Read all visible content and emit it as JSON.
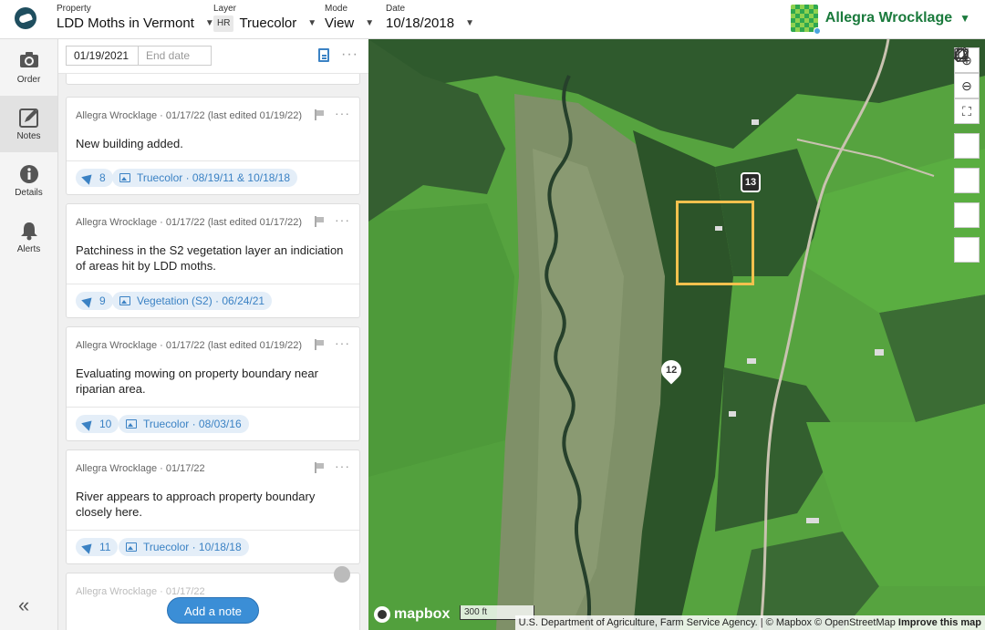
{
  "header": {
    "property_label": "Property",
    "property_value": "LDD Moths in Vermont",
    "layer_label": "Layer",
    "layer_badge": "HR",
    "layer_value": "Truecolor",
    "mode_label": "Mode",
    "mode_value": "View",
    "date_label": "Date",
    "date_value": "10/18/2018",
    "user_name": "Allegra Wrocklage"
  },
  "rail": {
    "items": [
      {
        "label": "Order",
        "icon": "camera-icon"
      },
      {
        "label": "Notes",
        "icon": "notes-icon"
      },
      {
        "label": "Details",
        "icon": "info-icon"
      },
      {
        "label": "Alerts",
        "icon": "bell-icon"
      }
    ],
    "collapse_glyph": "«"
  },
  "panel": {
    "start_date": "01/19/2021",
    "end_date_placeholder": "End date",
    "more_glyph": "···",
    "notes": [
      {
        "meta": "Allegra Wrocklage · 01/17/22 (last edited 01/19/22)",
        "body": "New building added.",
        "count": "8",
        "layer": "Truecolor · 08/19/11 & 10/18/18"
      },
      {
        "meta": "Allegra Wrocklage · 01/17/22 (last edited 01/17/22)",
        "body": "Patchiness in the S2 vegetation layer an indiciation of areas hit by LDD moths.",
        "count": "9",
        "layer": "Vegetation (S2) · 06/24/21"
      },
      {
        "meta": "Allegra Wrocklage · 01/17/22 (last edited 01/19/22)",
        "body": "Evaluating mowing on property boundary near riparian area.",
        "count": "10",
        "layer": "Truecolor · 08/03/16"
      },
      {
        "meta": "Allegra Wrocklage · 01/17/22",
        "body": "River appears to approach property boundary closely here.",
        "count": "11",
        "layer": "Truecolor · 10/18/18"
      },
      {
        "meta": "Allegra Wrocklage · 01/17/22",
        "body": "",
        "count": "",
        "layer": ""
      }
    ],
    "add_note_label": "Add a note"
  },
  "map": {
    "marker_13": "13",
    "marker_12": "12",
    "mapbox_label": "mapbox",
    "scale_label": "300 ft",
    "attribution": "U.S. Department of Agriculture, Farm Service Agency. | © Mapbox © OpenStreetMap",
    "improve_label": "Improve this map",
    "colors": {
      "field": "#4f9a3e",
      "forest": "#2f5a2e",
      "wetland": "#7d8f66",
      "aoi": "#f2c14e",
      "accent": "#3b8ed6"
    }
  }
}
